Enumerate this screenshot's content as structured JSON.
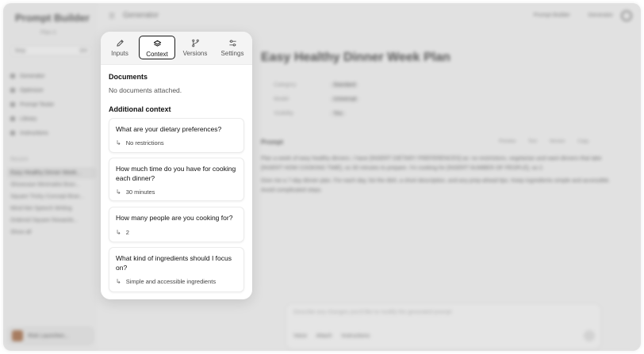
{
  "background": {
    "sidebar": {
      "title": "Prompt Builder",
      "subtitle": "Plan it",
      "select_label": "Step",
      "select_value": "3/4",
      "nav": [
        "Generator",
        "Optimizer",
        "Prompt Tester",
        "Library",
        "Instructions"
      ],
      "recent_label": "Recent",
      "recents": [
        "Easy Healthy Dinner Week...",
        "Showcase Minimalist Bran...",
        "Square Tricky Concept Bran...",
        "Mind-Net Speech Writing",
        "Ordered Square Rewards...",
        "Show all"
      ],
      "user_name": "Risk Launches..."
    },
    "topbar": {
      "menu_icon": "menu-icon",
      "title": "Generator",
      "link_primary": "Prompt Builder",
      "link_secondary": "Generator"
    },
    "main": {
      "title": "Easy Healthy Dinner Week Plan",
      "meta": [
        {
          "key": "Category",
          "value": "Standard"
        },
        {
          "key": "Model",
          "value": "Universal"
        },
        {
          "key": "Visibility",
          "value": "You"
        }
      ],
      "prompt_label": "Prompt",
      "prompt_tools": "Preview Test Version Copy",
      "prompt_text_1": "Plan a week of easy healthy dinners. I have [INSERT DIETARY PREFERENCES] as: no restrictions, vegetarian and want dinners that take [INSERT HOW COOKING TIME], so 30 minutes to prepare. I'm cooking for [INSERT NUMBER OF PEOPLE], so 2.",
      "prompt_text_2": "Give me a 7-day dinner plan. For each day, list the dish, a short description, and any prep-ahead tips. Keep ingredients simple and accessible. Avoid complicated steps.",
      "composer_placeholder": "Describe any changes you'd like to modify the generated prompt",
      "composer_tools": "Voice Attach Instructions"
    }
  },
  "popover": {
    "tabs": [
      {
        "label": "Inputs",
        "icon": "pencil-icon"
      },
      {
        "label": "Context",
        "icon": "layers-icon"
      },
      {
        "label": "Versions",
        "icon": "branch-icon"
      },
      {
        "label": "Settings",
        "icon": "sliders-icon"
      }
    ],
    "active_tab": "Context",
    "documents_heading": "Documents",
    "documents_empty": "No documents attached.",
    "additional_heading": "Additional context",
    "questions": [
      {
        "question": "What are your dietary preferences?",
        "answer": "No restrictions"
      },
      {
        "question": "How much time do you have for cooking each dinner?",
        "answer": "30 minutes"
      },
      {
        "question": "How many people are you cooking for?",
        "answer": "2"
      },
      {
        "question": "What kind of ingredients should I focus on?",
        "answer": "Simple and accessible ingredients"
      }
    ]
  },
  "colors": {
    "active_tab_border": "#1a1a1a",
    "popover_bg": "#ffffff",
    "tabbar_bg": "#f4f4f4"
  }
}
